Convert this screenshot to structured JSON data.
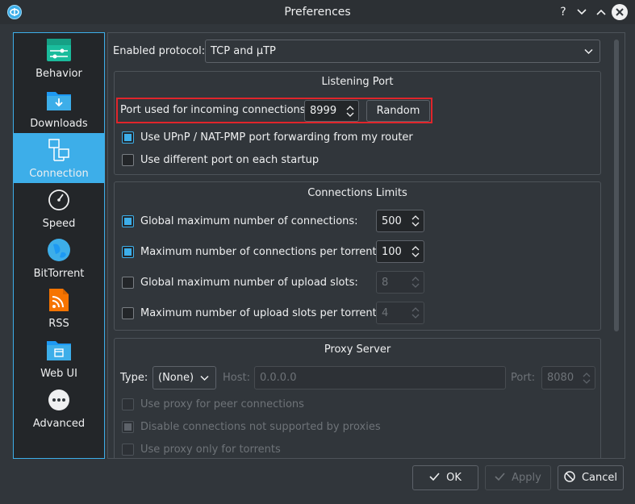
{
  "window": {
    "title": "Preferences",
    "controls": [
      "help-icon",
      "minimize-icon",
      "maximize-icon",
      "close-icon"
    ]
  },
  "sidebar": {
    "items": [
      {
        "label": "Behavior",
        "icon": "behavior-icon",
        "selected": false
      },
      {
        "label": "Downloads",
        "icon": "downloads-icon",
        "selected": false
      },
      {
        "label": "Connection",
        "icon": "connection-icon",
        "selected": true
      },
      {
        "label": "Speed",
        "icon": "speed-icon",
        "selected": false
      },
      {
        "label": "BitTorrent",
        "icon": "bittorrent-icon",
        "selected": false
      },
      {
        "label": "RSS",
        "icon": "rss-icon",
        "selected": false
      },
      {
        "label": "Web UI",
        "icon": "web-ui-icon",
        "selected": false
      },
      {
        "label": "Advanced",
        "icon": "advanced-icon",
        "selected": false
      }
    ]
  },
  "protocol": {
    "label": "Enabled protocol:",
    "value": "TCP and µTP"
  },
  "listening_port": {
    "title": "Listening Port",
    "port_label": "Port used for incoming connections:",
    "port_value": "8999",
    "random_label": "Random",
    "upnp_label": "Use UPnP / NAT-PMP port forwarding from my router",
    "upnp_checked": true,
    "diff_port_label": "Use different port on each startup",
    "diff_port_checked": false
  },
  "connection_limits": {
    "title": "Connections Limits",
    "rows": [
      {
        "label": "Global maximum number of connections:",
        "checked": true,
        "value": "500",
        "enabled": true
      },
      {
        "label": "Maximum number of connections per torrent:",
        "checked": true,
        "value": "100",
        "enabled": true
      },
      {
        "label": "Global maximum number of upload slots:",
        "checked": false,
        "value": "8",
        "enabled": false
      },
      {
        "label": "Maximum number of upload slots per torrent:",
        "checked": false,
        "value": "4",
        "enabled": false
      }
    ]
  },
  "proxy": {
    "title": "Proxy Server",
    "type_label": "Type:",
    "type_value": "(None)",
    "host_label": "Host:",
    "host_value": "0.0.0.0",
    "port_label": "Port:",
    "port_value": "8080",
    "options": [
      {
        "label": "Use proxy for peer connections",
        "checked": false
      },
      {
        "label": "Disable connections not supported by proxies",
        "checked": true
      },
      {
        "label": "Use proxy only for torrents",
        "checked": false
      }
    ]
  },
  "buttons": {
    "ok": "OK",
    "apply": "Apply",
    "cancel": "Cancel"
  },
  "colors": {
    "accent": "#3daee9",
    "highlight_box": "#e0252b",
    "background": "#31363b"
  }
}
